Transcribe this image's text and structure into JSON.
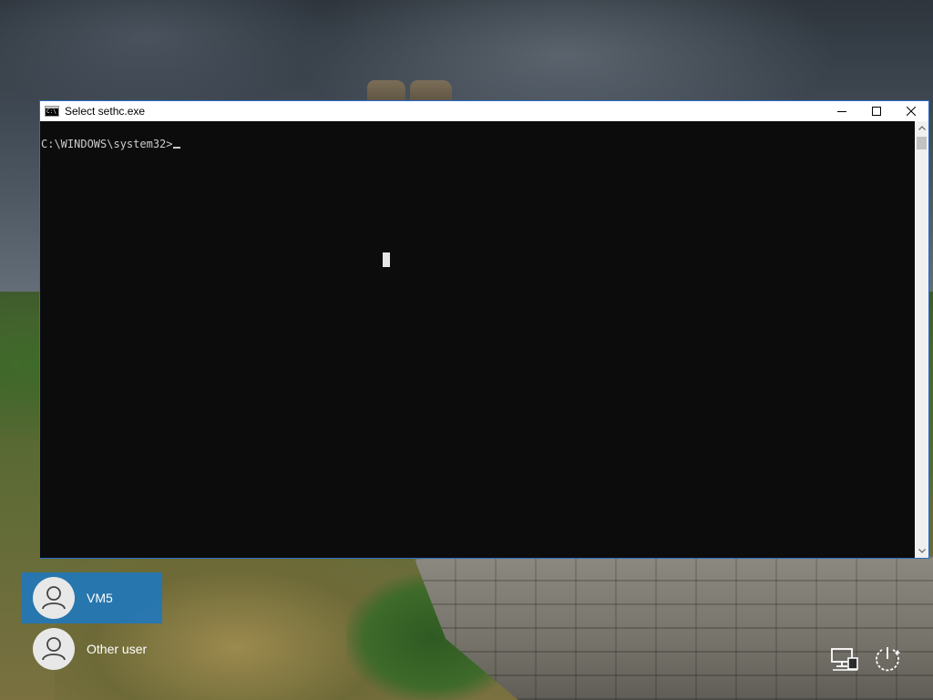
{
  "window": {
    "title": "Select sethc.exe",
    "icon": "command-prompt-icon",
    "controls": {
      "minimize": "—",
      "maximize": "☐",
      "close": "✕"
    }
  },
  "console": {
    "prompt": "C:\\WINDOWS\\system32>",
    "text_color": "#cccccc",
    "background": "#0c0c0c"
  },
  "users": [
    {
      "name": "VM5",
      "selected": true
    },
    {
      "name": "Other user",
      "selected": false
    }
  ],
  "system_icons": [
    "network-icon",
    "power-icon"
  ],
  "colors": {
    "selection": "#1e78be",
    "window_border": "#2b6cc4"
  }
}
